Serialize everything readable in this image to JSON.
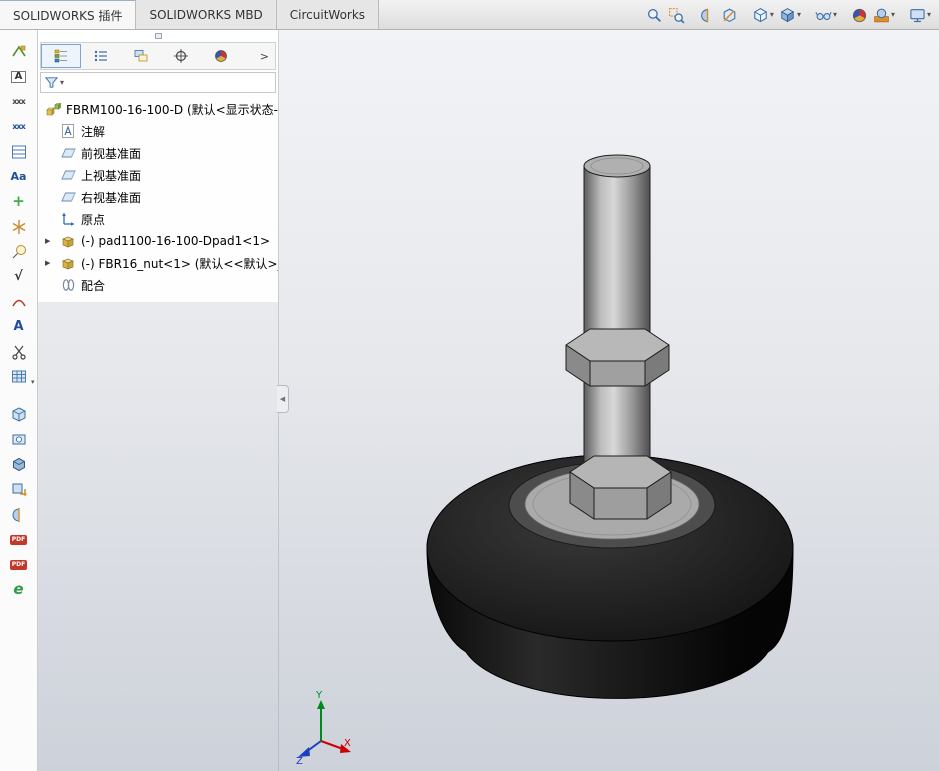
{
  "command_tabs": [
    {
      "label": "SOLIDWORKS 插件",
      "active": true
    },
    {
      "label": "SOLIDWORKS MBD",
      "active": false
    },
    {
      "label": "CircuitWorks",
      "active": false
    }
  ],
  "ui_glyphs": {
    "caret": "▾",
    "chevron_right": ">",
    "collapse_arrow": "◀"
  },
  "heads_up": {
    "items": [
      {
        "name": "zoom-to-fit-icon",
        "dropdown": false
      },
      {
        "name": "zoom-to-area-icon",
        "dropdown": false
      },
      {
        "name": "section-view-icon",
        "dropdown": false
      },
      {
        "name": "3d-drawing-view-icon",
        "dropdown": false
      },
      {
        "name": "view-orientation-icon",
        "dropdown": true
      },
      {
        "name": "display-style-icon",
        "dropdown": true
      },
      {
        "name": "hide-show-items-icon",
        "dropdown": true
      },
      {
        "name": "edit-appearance-icon",
        "dropdown": false
      },
      {
        "name": "apply-scene-icon",
        "dropdown": true
      },
      {
        "name": "view-settings-icon",
        "dropdown": true
      }
    ]
  },
  "left_toolbar": {
    "items": [
      {
        "name": "weld-symbol-tool-icon",
        "glyph": ""
      },
      {
        "name": "datum-feature-icon",
        "glyph": "A"
      },
      {
        "name": "balloon-note-icon",
        "glyph": "xxx"
      },
      {
        "name": "stacked-balloon-icon",
        "glyph": "xxx"
      },
      {
        "name": "revision-table-icon",
        "glyph": ""
      },
      {
        "name": "spell-check-icon",
        "glyph": "Aa"
      },
      {
        "name": "center-mark-icon",
        "glyph": "+"
      },
      {
        "name": "hatch-pattern-icon",
        "glyph": ""
      },
      {
        "name": "balloon-icon",
        "glyph": ""
      },
      {
        "name": "surface-finish-icon",
        "glyph": "√"
      },
      {
        "name": "weld-bead-icon",
        "glyph": ""
      },
      {
        "name": "note-icon",
        "glyph": "A"
      },
      {
        "name": "trim-icon",
        "glyph": ""
      },
      {
        "name": "tables-icon",
        "glyph": ""
      },
      {
        "name": "3d-pdf-icon",
        "glyph": ""
      },
      {
        "name": "capture-3d-view-icon",
        "glyph": ""
      },
      {
        "name": "model-view-icon",
        "glyph": ""
      },
      {
        "name": "export-model-icon",
        "glyph": ""
      },
      {
        "name": "section-tool-icon",
        "glyph": ""
      },
      {
        "name": "save-as-pdf-icon",
        "glyph": "PDF"
      },
      {
        "name": "save-as-pdf-alt-icon",
        "glyph": "PDF"
      },
      {
        "name": "edrawings-icon",
        "glyph": "e"
      }
    ]
  },
  "feature_panel": {
    "tabs": [
      {
        "name": "featuremanager-design-tree-tab",
        "active": true
      },
      {
        "name": "propertymanager-tab",
        "active": false
      },
      {
        "name": "configurationmanager-tab",
        "active": false
      },
      {
        "name": "dimxpertmanager-tab",
        "active": false
      },
      {
        "name": "displaymanager-tab",
        "active": false
      }
    ],
    "tree": [
      {
        "label": "FBRM100-16-100-D  (默认<显示状态-",
        "icon": "assembly",
        "level": 0,
        "expander": ""
      },
      {
        "label": "注解",
        "icon": "annotations",
        "level": 1,
        "expander": ""
      },
      {
        "label": "前视基准面",
        "icon": "plane",
        "level": 1,
        "expander": ""
      },
      {
        "label": "上视基准面",
        "icon": "plane",
        "level": 1,
        "expander": ""
      },
      {
        "label": "右视基准面",
        "icon": "plane",
        "level": 1,
        "expander": ""
      },
      {
        "label": "原点",
        "icon": "origin",
        "level": 1,
        "expander": ""
      },
      {
        "label": "(-) pad1100-16-100-Dpad1<1>",
        "icon": "component",
        "level": 1,
        "expander": "▶"
      },
      {
        "label": "(-) FBR16_nut<1>  (默认<<默认>_",
        "icon": "component",
        "level": 1,
        "expander": "▶"
      },
      {
        "label": "配合",
        "icon": "mates",
        "level": 1,
        "expander": ""
      }
    ]
  },
  "viewport": {
    "triad": {
      "x_label": "X",
      "y_label": "Y",
      "z_label": "Z"
    }
  },
  "colors": {
    "accent_blue": "#3a6ea5",
    "viewport_top": "#f2f3f6",
    "viewport_bottom": "#cdd1d9",
    "base_black": "#141414",
    "metal_gray": "#a8a8a8"
  }
}
